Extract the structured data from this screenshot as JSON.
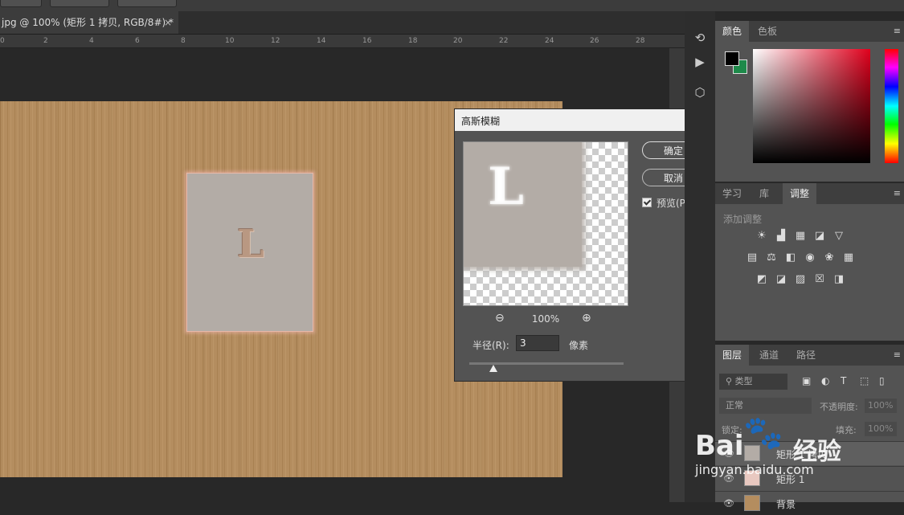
{
  "document": {
    "tab_title": "jpg @ 100% (矩形 1 拷贝, RGB/8#) *",
    "close_glyph": "×",
    "canvas_letter": "L"
  },
  "ruler": {
    "ticks": [
      "0",
      "2",
      "4",
      "6",
      "8",
      "10",
      "12",
      "14",
      "16",
      "18",
      "20",
      "22",
      "24",
      "26",
      "28"
    ]
  },
  "dialog": {
    "title": "高斯模糊",
    "close_glyph": "✕",
    "preview_letter": "L",
    "zoom_out_glyph": "⊖",
    "zoom_in_glyph": "⊕",
    "zoom_level": "100%",
    "ok_label": "确定",
    "cancel_label": "取消",
    "preview_label": "预览(P)",
    "preview_checked": true,
    "radius_label": "半径(R):",
    "radius_value": "3",
    "radius_unit": "像素"
  },
  "color_panel": {
    "tabs": [
      "颜色",
      "色板"
    ],
    "active_tab": "颜色",
    "foreground": "#000000",
    "background": "#1e8a4a"
  },
  "adjust_panel": {
    "tabs": [
      "学习",
      "库",
      "调整"
    ],
    "active_tab": "调整",
    "add_label": "添加调整"
  },
  "layers_panel": {
    "tabs": [
      "图层",
      "通道",
      "路径"
    ],
    "active_tab": "图层",
    "filter_label": "类型",
    "blend_mode": "正常",
    "opacity_label": "不透明度:",
    "opacity_value": "100%",
    "lock_label": "锁定:",
    "fill_label": "填充:",
    "fill_value": "100%",
    "layers": [
      {
        "name": "矩形 1 拷贝"
      },
      {
        "name": "矩形 1"
      },
      {
        "name": "背景"
      }
    ]
  },
  "watermark": {
    "brand": "Bai",
    "jingyan": "经验",
    "url": "jingyan.baidu.com"
  }
}
